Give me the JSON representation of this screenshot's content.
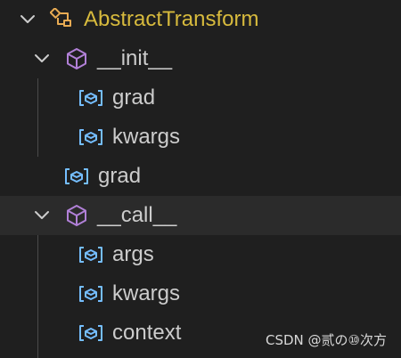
{
  "tree": {
    "root": {
      "label": "AbstractTransform",
      "icon": "class-icon"
    },
    "init": {
      "label": "__init__",
      "icon": "method-icon",
      "children": [
        {
          "label": "grad",
          "icon": "variable-icon"
        },
        {
          "label": "kwargs",
          "icon": "variable-icon"
        }
      ]
    },
    "grad": {
      "label": "grad",
      "icon": "variable-icon"
    },
    "call": {
      "label": "__call__",
      "icon": "method-icon",
      "children": [
        {
          "label": "args",
          "icon": "variable-icon"
        },
        {
          "label": "kwargs",
          "icon": "variable-icon"
        },
        {
          "label": "context",
          "icon": "variable-icon"
        }
      ]
    }
  },
  "watermark": "CSDN @贰の⑩次方",
  "colors": {
    "background": "#1f1f1f",
    "text": "#cccccc",
    "class_name": "#d7ba3d",
    "method_icon": "#b180d7",
    "variable_icon": "#75beff"
  }
}
